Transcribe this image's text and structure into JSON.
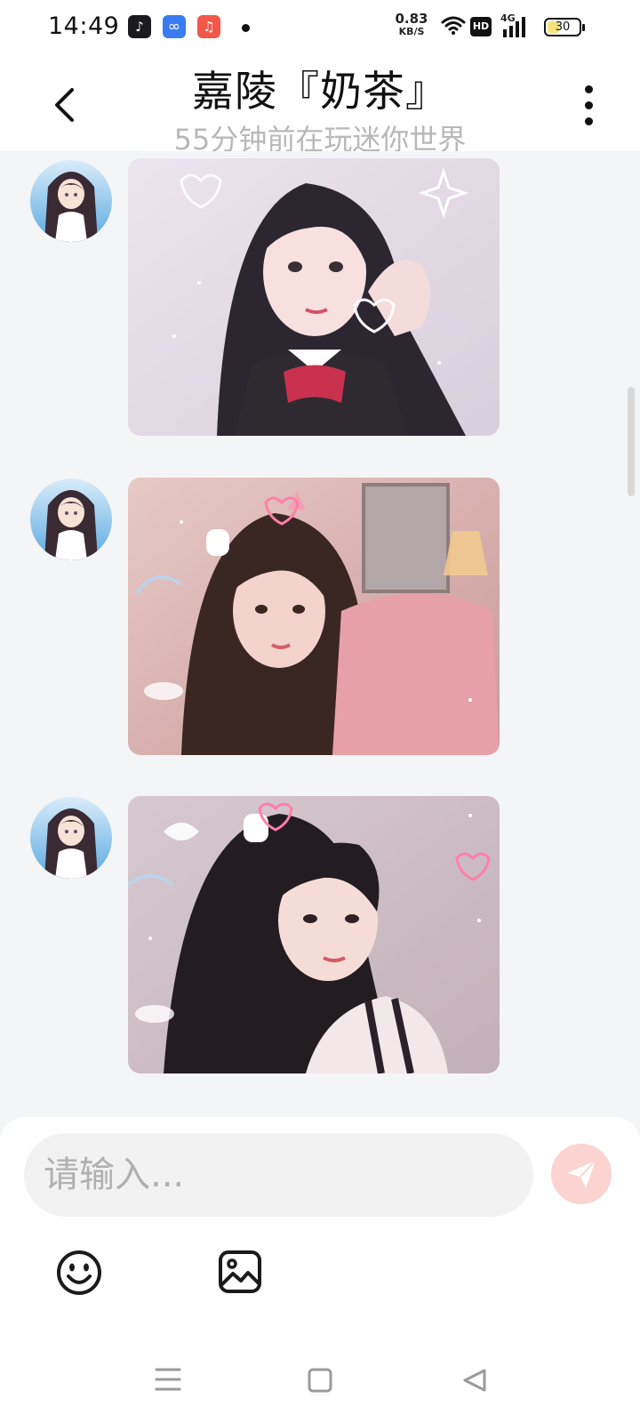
{
  "status_bar": {
    "time": "14:49",
    "net_speed_value": "0.83",
    "net_speed_unit": "KB/S",
    "hd_label": "HD",
    "network_type": "4G",
    "battery_level": "30",
    "apps": [
      "tiktok-icon",
      "infinity-icon",
      "music-icon"
    ]
  },
  "header": {
    "title": "嘉陵『奶茶』",
    "subtitle": "55分钟前在玩迷你世界"
  },
  "messages": [
    {
      "sender": "contact",
      "type": "image",
      "icon": "photo-girl-school-uniform"
    },
    {
      "sender": "contact",
      "type": "image",
      "icon": "photo-girl-pink-sweater"
    },
    {
      "sender": "contact",
      "type": "image",
      "icon": "photo-girl-white-bow"
    }
  ],
  "input": {
    "placeholder": "请输入..."
  },
  "toolbar": {
    "buttons": [
      "emoji-icon",
      "image-icon"
    ]
  },
  "colors": {
    "send_button_bg": "#fbd3d0",
    "input_bg": "#f2f2f2",
    "chat_bg": "#f4f5f7"
  }
}
